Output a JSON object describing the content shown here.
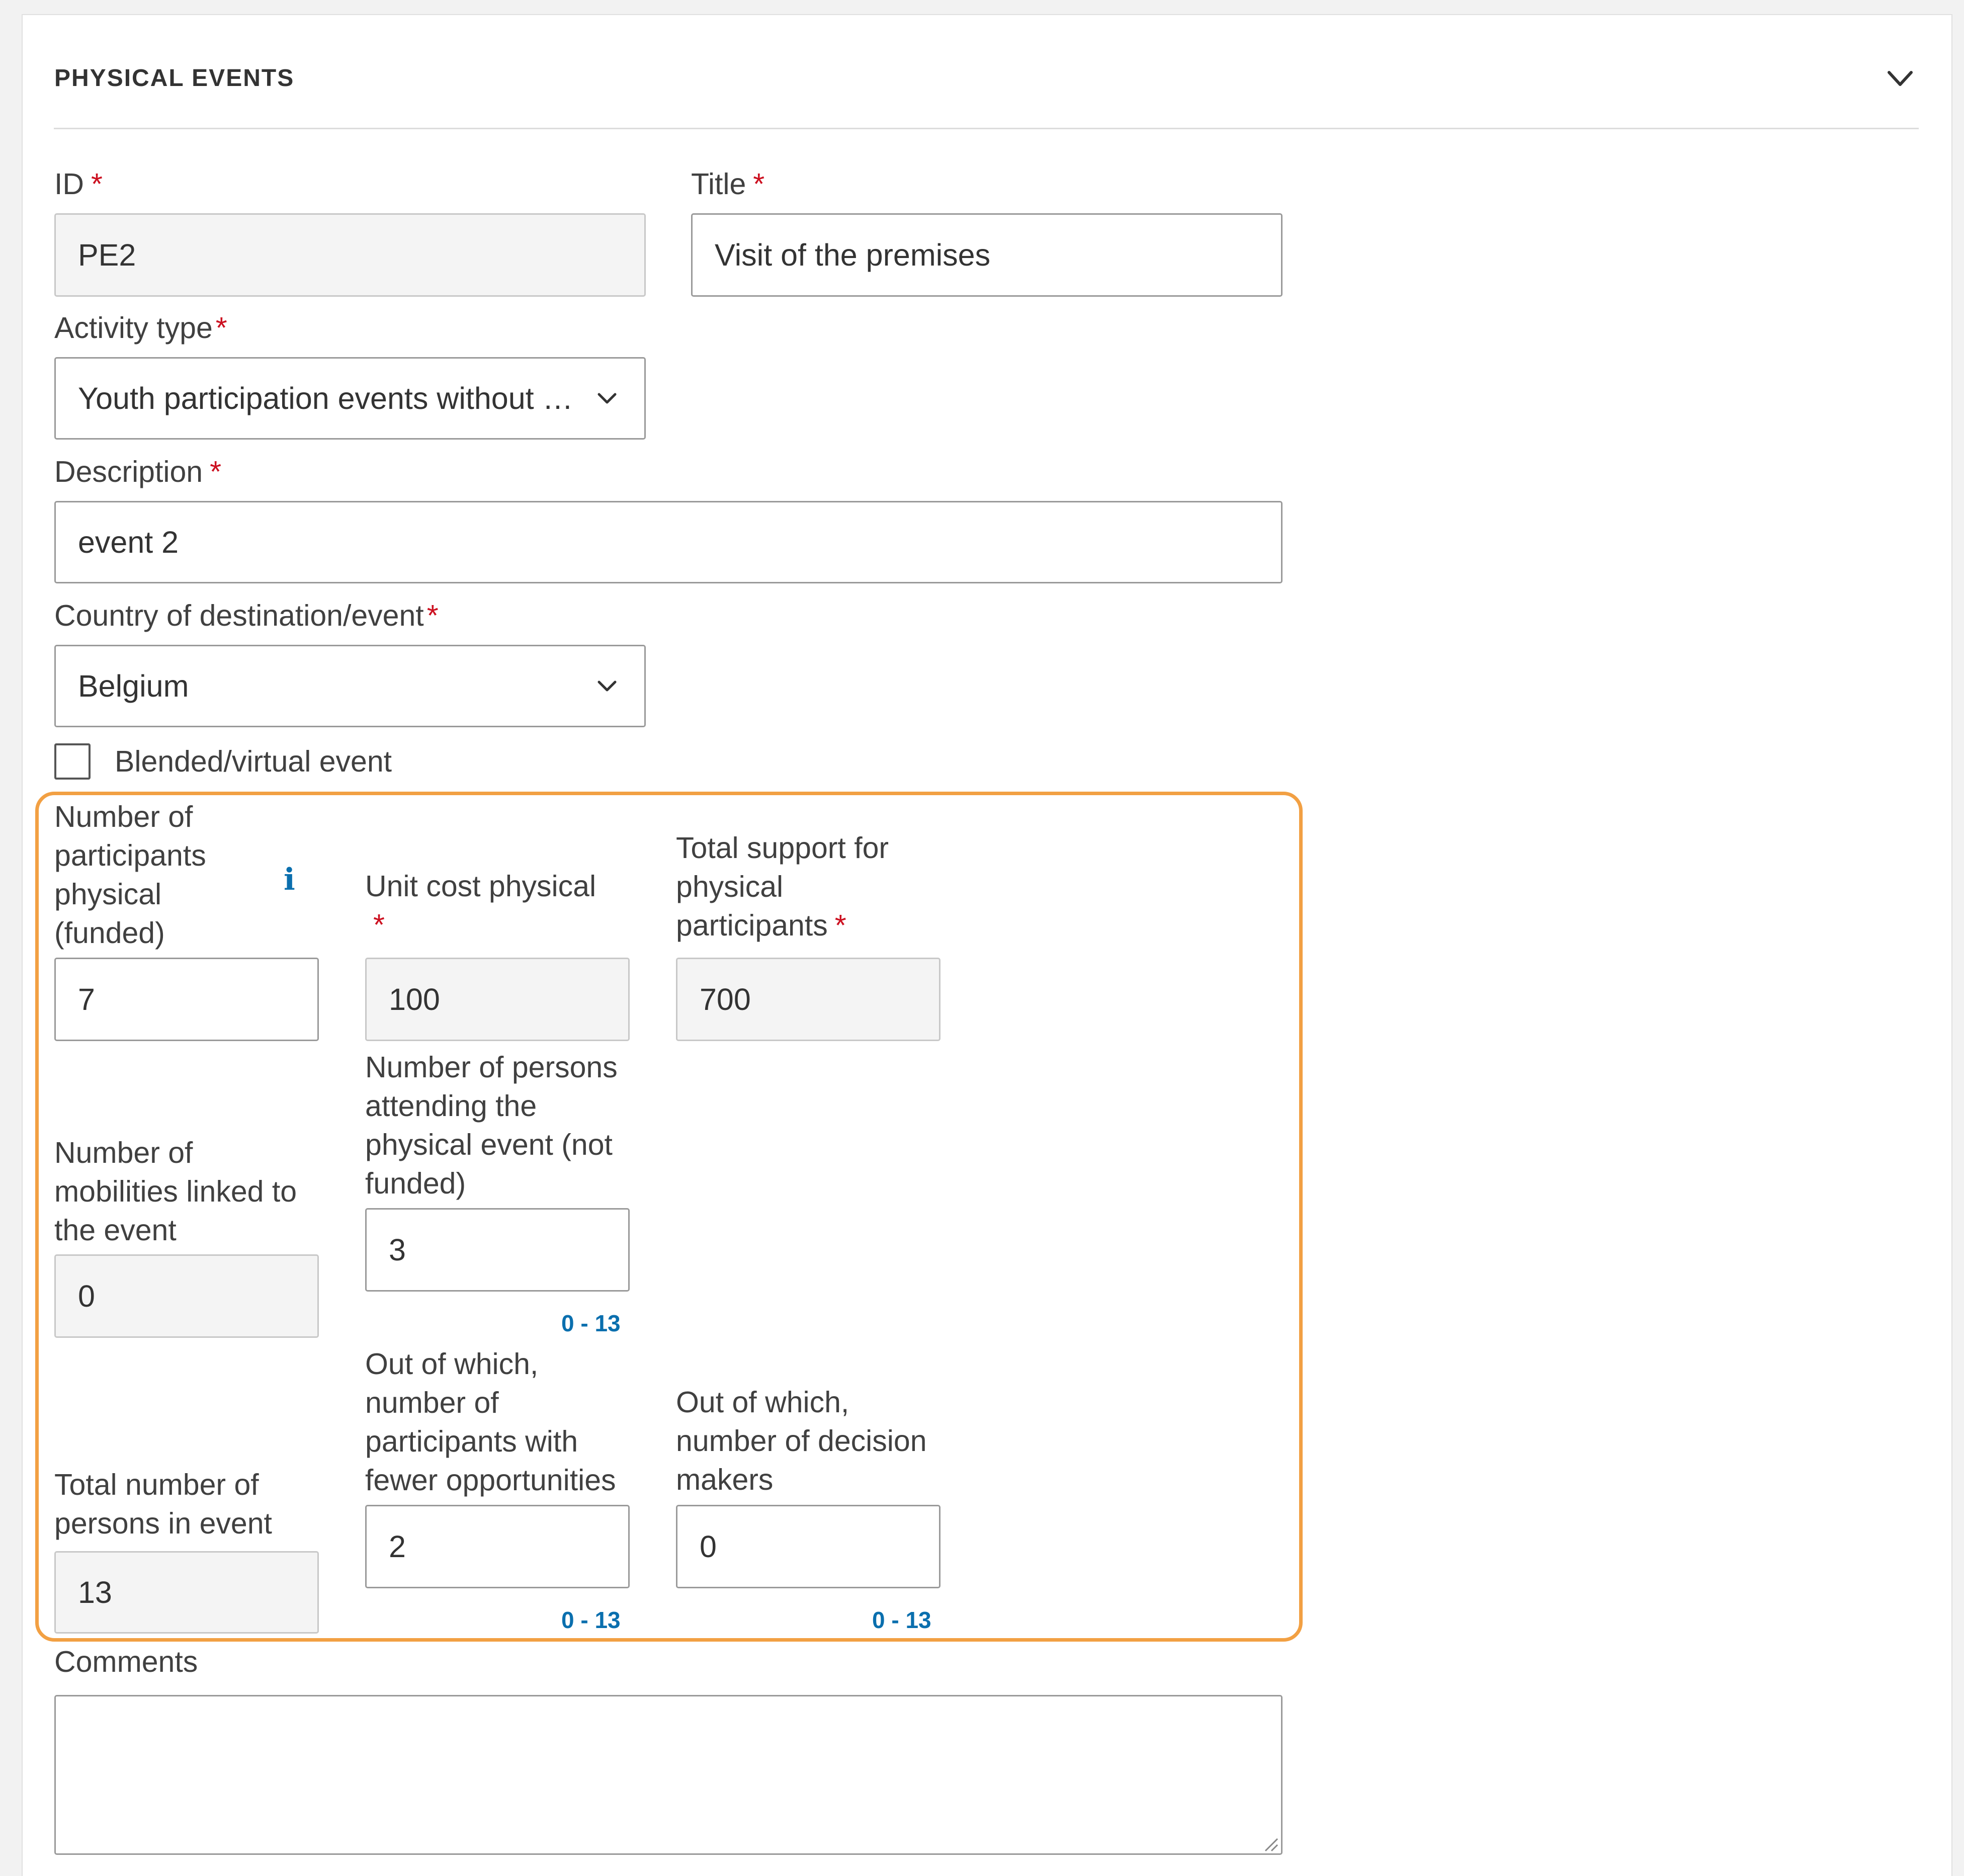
{
  "section": {
    "title": "PHYSICAL EVENTS"
  },
  "form": {
    "required_marker": "*",
    "id": {
      "label": "ID",
      "value": "PE2"
    },
    "title": {
      "label": "Title",
      "value": "Visit of the premises"
    },
    "activity_type": {
      "label": "Activity type",
      "value": "Youth participation events without …"
    },
    "description": {
      "label": "Description",
      "value": "event 2"
    },
    "country": {
      "label": "Country of destination/event",
      "value": "Belgium"
    },
    "blended": {
      "label": "Blended/virtual event",
      "checked": false
    },
    "participants_funded": {
      "label_lines": [
        "Number of",
        "participants",
        "physical",
        "(funded)"
      ],
      "value": "7",
      "info_icon": "info-icon"
    },
    "unit_cost": {
      "label": "Unit cost physical",
      "value": "100"
    },
    "total_support": {
      "label_lines": [
        "Total support for",
        "physical",
        "participants"
      ],
      "value": "700"
    },
    "mobilities": {
      "label_lines": [
        "Number of",
        "mobilities linked to",
        "the event"
      ],
      "value": "0"
    },
    "persons_not_funded": {
      "label_lines": [
        "Number of persons",
        "attending the",
        "physical event (not",
        "funded)"
      ],
      "value": "3",
      "range": "0 - 13"
    },
    "total_persons": {
      "label_lines": [
        "Total number of",
        "persons in event"
      ],
      "value": "13"
    },
    "fewer_opportunities": {
      "label_lines": [
        "Out of which,",
        "number of",
        "participants with",
        "fewer opportunities"
      ],
      "value": "2",
      "range": "0 - 13"
    },
    "decision_makers": {
      "label_lines": [
        "Out of which,",
        "number of decision",
        "makers"
      ],
      "value": "0",
      "range": "0 - 13"
    },
    "comments": {
      "label": "Comments",
      "value": ""
    }
  },
  "colors": {
    "required": "#cc1020",
    "range_text": "#0a6fae",
    "highlight_border": "#f2a043",
    "readonly_bg": "#f4f4f4"
  }
}
